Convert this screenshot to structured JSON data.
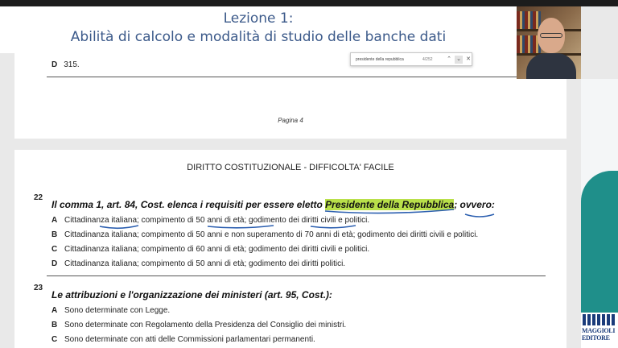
{
  "slide": {
    "title_line1": "Lezione 1:",
    "title_line2": "Abilità di calcolo e modalità di studio delle banche dati"
  },
  "find_bar": {
    "query": "presidente della repubblica",
    "count": "4/252"
  },
  "page_prev": {
    "option_letter": "D",
    "option_text": "315.",
    "page_label": "Pagina 4"
  },
  "page_current": {
    "section_title": "DIRITTO COSTITUZIONALE - DIFFICOLTA' FACILE",
    "q22": {
      "number": "22",
      "text_before": "Il comma 1, art. 84, Cost. elenca i requisiti per essere eletto ",
      "highlight": "Presidente della Repubblica",
      "text_after": "; ovvero:",
      "options": [
        {
          "letter": "A",
          "text": "Cittadinanza italiana; compimento di 50 anni di età; godimento dei diritti civili e politici."
        },
        {
          "letter": "B",
          "text": "Cittadinanza italiana; compimento di 50 anni e non superamento di 70 anni di età; godimento dei diritti civili e politici."
        },
        {
          "letter": "C",
          "text": "Cittadinanza italiana; compimento di 60 anni di età; godimento dei diritti civili e politici."
        },
        {
          "letter": "D",
          "text": "Cittadinanza italiana; compimento di 50 anni di età; godimento dei diritti politici."
        }
      ]
    },
    "q23": {
      "number": "23",
      "text": "Le attribuzioni e l'organizzazione dei ministeri (art. 95, Cost.):",
      "options": [
        {
          "letter": "A",
          "text": "Sono determinate con Legge."
        },
        {
          "letter": "B",
          "text": "Sono determinate con Regolamento della Presidenza del Consiglio dei ministri."
        },
        {
          "letter": "C",
          "text": "Sono determinate con atti delle Commissioni parlamentari permanenti."
        }
      ]
    }
  },
  "publisher": {
    "logo_line1": "MAGGIOLI",
    "logo_line2": "EDITORE"
  },
  "colors": {
    "title": "#3c5a8a",
    "highlight": "#b9e04a",
    "ink": "#2c5fb0",
    "teal": "#1f8f8a"
  },
  "icons": [
    "chevron-up-icon",
    "chevron-down-icon",
    "close-icon",
    "maggioli-logo"
  ]
}
